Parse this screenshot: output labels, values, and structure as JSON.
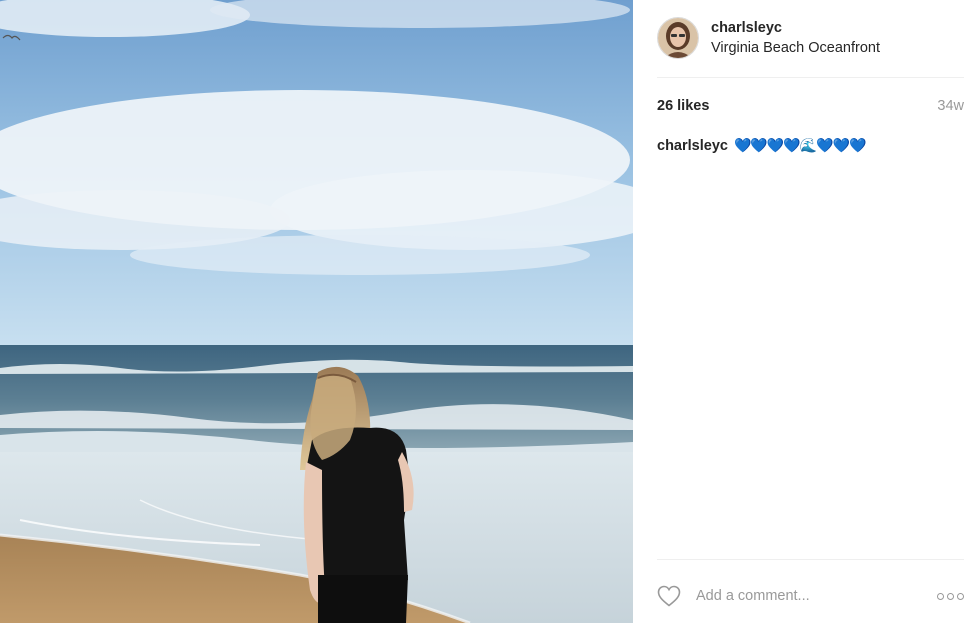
{
  "photo": {
    "alt": "Photo by charlsleyc"
  },
  "post": {
    "username": "charlsleyc",
    "location": "Virginia Beach Oceanfront",
    "likes": "26 likes",
    "age": "34w",
    "caption_user": "charlsleyc",
    "caption_text": "💙💙💙💙🌊💙💙💙"
  },
  "comment": {
    "placeholder": "Add a comment..."
  },
  "icons": {
    "like": "heart-icon",
    "more": "more-options-icon"
  },
  "colors": {
    "text": "#262626",
    "muted": "#999999",
    "divider": "#efefef",
    "sky": "#7fb2da",
    "ocean": "#4b6f86",
    "sand": "#b08a5c"
  }
}
